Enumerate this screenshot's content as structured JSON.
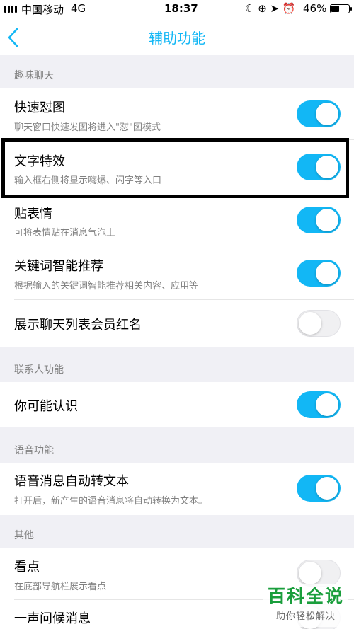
{
  "status_bar": {
    "carrier": "中国移动",
    "network": "4G",
    "time": "18:37",
    "icons": [
      "moon-icon",
      "rotation-lock-icon",
      "location-icon",
      "alarm-icon"
    ],
    "icon_glyphs": "☾ ⊕ ➤ ⏰",
    "battery_percent": "46%",
    "battery_level": 0.46
  },
  "nav": {
    "title": "辅助功能",
    "accent_color": "#12b7f5"
  },
  "sections": {
    "fun_chat": {
      "header": "趣味聊天",
      "rows": [
        {
          "title": "快速怼图",
          "subtitle": "聊天窗口快速发图将进入\"怼\"图模式",
          "enabled": true
        },
        {
          "title": "文字特效",
          "subtitle": "输入框右侧将显示嗨爆、闪字等入口",
          "enabled": true,
          "highlighted": true
        },
        {
          "title": "贴表情",
          "subtitle": "可将表情贴在消息气泡上",
          "enabled": true
        },
        {
          "title": "关键词智能推荐",
          "subtitle": "根据输入的关键词智能推荐相关内容、应用等",
          "enabled": true
        },
        {
          "title": "展示聊天列表会员红名",
          "enabled": false
        }
      ]
    },
    "contacts": {
      "header": "联系人功能",
      "rows": [
        {
          "title": "你可能认识",
          "enabled": true
        }
      ]
    },
    "voice": {
      "header": "语音功能",
      "rows": [
        {
          "title": "语音消息自动转文本",
          "subtitle": "打开后，新产生的语音消息将自动转换为文本。",
          "enabled": true
        }
      ]
    },
    "other": {
      "header": "其他",
      "rows": [
        {
          "title": "看点",
          "subtitle": "在底部导航栏展示看点",
          "enabled": false
        },
        {
          "title": "一声问候消息",
          "enabled": false
        }
      ]
    }
  },
  "watermark": {
    "title": "百科全说",
    "subtitle": "助你轻松解决",
    "color": "#1a9e3c"
  }
}
